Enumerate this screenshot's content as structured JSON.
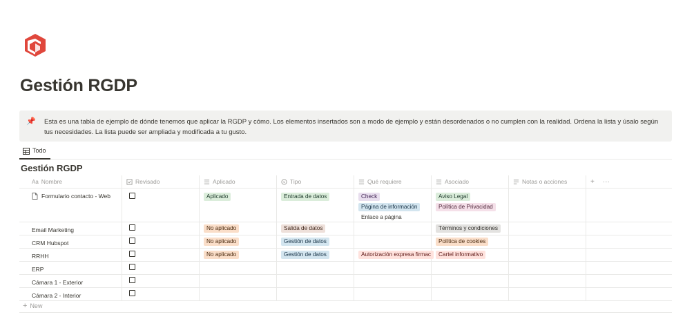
{
  "page": {
    "title": "Gestión RGDP",
    "logo_icon": "cube-logo-icon",
    "logo_color": "#e0473c"
  },
  "callout": {
    "icon": "pushpin-icon",
    "text": "Esta es una tabla de ejemplo de dónde tenemos que aplicar la RGDP y cómo. Los elementos insertados son a modo de ejemplo y están desordenados o no cumplen con la realidad. Ordena la lista y úsalo según tus necesidades. La lista puede ser ampliada y modificada a tu gusto."
  },
  "view": {
    "tab_label": "Todo",
    "tab_icon": "table-icon"
  },
  "database": {
    "title": "Gestión RGDP",
    "columns": [
      {
        "label": "Nombre",
        "icon": "text-icon"
      },
      {
        "label": "Revisado",
        "icon": "checkbox-icon"
      },
      {
        "label": "Aplicado",
        "icon": "list-icon"
      },
      {
        "label": "Tipo",
        "icon": "select-icon"
      },
      {
        "label": "Qué requiere",
        "icon": "list-icon"
      },
      {
        "label": "Asociado",
        "icon": "list-icon"
      },
      {
        "label": "Notas o acciones",
        "icon": "text-lines-icon"
      }
    ],
    "add_column": "+",
    "more_options": "···",
    "rows": [
      {
        "name": "Formulario contacto - Web",
        "has_page_icon": true,
        "aplicado": "Aplicado",
        "tipo": "Entrada de datos",
        "requiere": [
          "Check",
          "Página de información",
          "Enlace a página"
        ],
        "asociado": [
          "Aviso Legal",
          "Política de Privacidad"
        ]
      },
      {
        "name": "Email Marketing",
        "aplicado": "No aplicado",
        "tipo": "Salida de datos",
        "requiere": [],
        "asociado": [
          "Términos y condiciones"
        ]
      },
      {
        "name": "CRM Hubspot",
        "aplicado": "No aplicado",
        "tipo": "Gestión de datos",
        "requiere": [],
        "asociado": [
          "Política de cookies"
        ]
      },
      {
        "name": "RRHH",
        "aplicado": "No aplicado",
        "tipo": "Gestión de datos",
        "requiere": [
          "Autorización expresa firmac"
        ],
        "asociado": [
          "Cartel informativo"
        ]
      },
      {
        "name": "ERP",
        "aplicado": "",
        "tipo": "",
        "requiere": [],
        "asociado": []
      },
      {
        "name": "Cámara 1 - Exterior",
        "aplicado": "",
        "tipo": "",
        "requiere": [],
        "asociado": []
      },
      {
        "name": "Cámara 2 - Interior",
        "aplicado": "",
        "tipo": "",
        "requiere": [],
        "asociado": []
      }
    ],
    "new_label": "New"
  }
}
